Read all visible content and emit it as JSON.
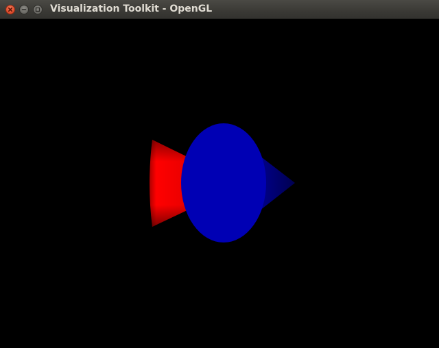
{
  "window": {
    "title": "Visualization Toolkit - OpenGL",
    "controls": {
      "close_icon": "close-icon",
      "minimize_icon": "minimize-icon",
      "maximize_icon": "maximize-icon"
    }
  },
  "scene": {
    "background": "#000000",
    "objects": [
      {
        "name": "red-cone",
        "color": "#ff0000"
      },
      {
        "name": "blue-cone",
        "color": "#0000c8"
      },
      {
        "name": "blue-disc",
        "color": "#0000b4"
      }
    ]
  }
}
